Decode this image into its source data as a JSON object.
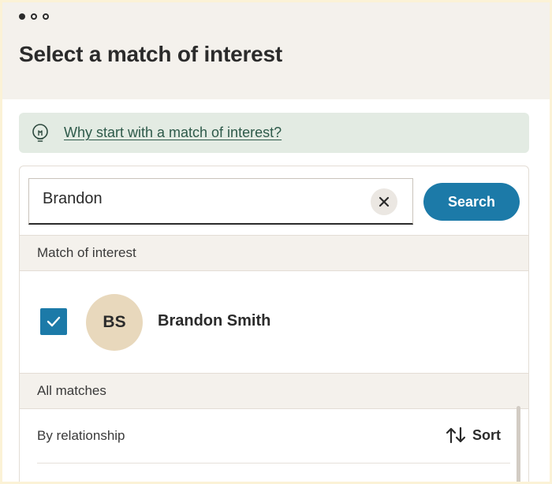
{
  "page": {
    "title": "Select a match of interest"
  },
  "info": {
    "link_text": "Why start with a match of interest?",
    "icon": "lightbulb-icon"
  },
  "search": {
    "value": "Brandon",
    "clear_icon": "close-icon",
    "button_label": "Search"
  },
  "sections": {
    "match_of_interest": "Match of interest",
    "all_matches": "All matches"
  },
  "selected_match": {
    "initials": "BS",
    "name": "Brandon Smith",
    "checked": true
  },
  "list": {
    "group_label": "By relationship",
    "sort_label": "Sort",
    "sort_icon": "sort-arrows-icon"
  },
  "colors": {
    "accent": "#1c7aa8",
    "info_bg": "#e3ebe3",
    "avatar_bg": "#e8d8bc",
    "header_bg": "#f4f1ec"
  }
}
